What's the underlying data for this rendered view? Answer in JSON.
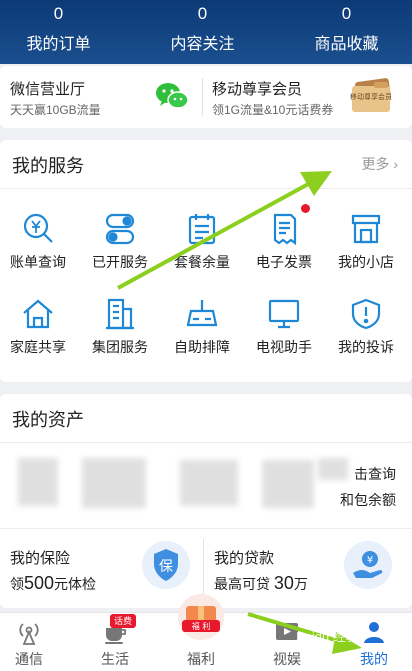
{
  "header": {
    "stats": [
      {
        "count": "0",
        "label": "我的订单"
      },
      {
        "count": "0",
        "label": "内容关注"
      },
      {
        "count": "0",
        "label": "商品收藏"
      }
    ]
  },
  "promo": {
    "left": {
      "title": "微信营业厅",
      "subtitle": "天天赢10GB流量",
      "icon": "wechat-icon"
    },
    "right": {
      "title": "移动尊享会员",
      "subtitle": "领1G流量&10元话费券",
      "icon_text": "移动尊享会员",
      "icon": "vip-card-icon"
    }
  },
  "services": {
    "title": "我的服务",
    "more": "更多",
    "items": [
      {
        "label": "账单查询",
        "icon": "bill-search-icon"
      },
      {
        "label": "已开服务",
        "icon": "toggle-services-icon"
      },
      {
        "label": "套餐余量",
        "icon": "plan-balance-icon"
      },
      {
        "label": "电子发票",
        "icon": "invoice-icon"
      },
      {
        "label": "我的小店",
        "icon": "shop-icon"
      },
      {
        "label": "家庭共享",
        "icon": "home-icon"
      },
      {
        "label": "集团服务",
        "icon": "building-icon"
      },
      {
        "label": "自助排障",
        "icon": "router-icon"
      },
      {
        "label": "电视助手",
        "icon": "tv-icon"
      },
      {
        "label": "我的投诉",
        "icon": "complaint-icon"
      }
    ]
  },
  "assets": {
    "title": "我的资产",
    "link1": "击查询",
    "link2": "和包余额",
    "insurance": {
      "title": "我的保险",
      "prefix": "领",
      "amount": "500",
      "suffix": "元体检",
      "icon_text": "保"
    },
    "loan": {
      "title": "我的贷款",
      "prefix": "最高可贷 ",
      "amount": "30",
      "suffix": "万",
      "icon_text": "¥"
    }
  },
  "nav": {
    "items": [
      {
        "label": "通信",
        "icon": "signal-tower-icon"
      },
      {
        "label": "生活",
        "icon": "coffee-cup-icon",
        "tag": "话费"
      },
      {
        "label": "福利",
        "icon": "gift-icon",
        "badge": "福 利"
      },
      {
        "label": "视娱",
        "icon": "video-play-icon"
      },
      {
        "label": "我的",
        "icon": "user-icon"
      }
    ],
    "watermark": "Baidu 经验"
  },
  "colors": {
    "header": "#0c3a77",
    "accent_blue": "#1e88d6",
    "active_tab": "#1e6fd6",
    "arrow_green": "#8ccf1e",
    "red_dot": "#e8192c"
  }
}
